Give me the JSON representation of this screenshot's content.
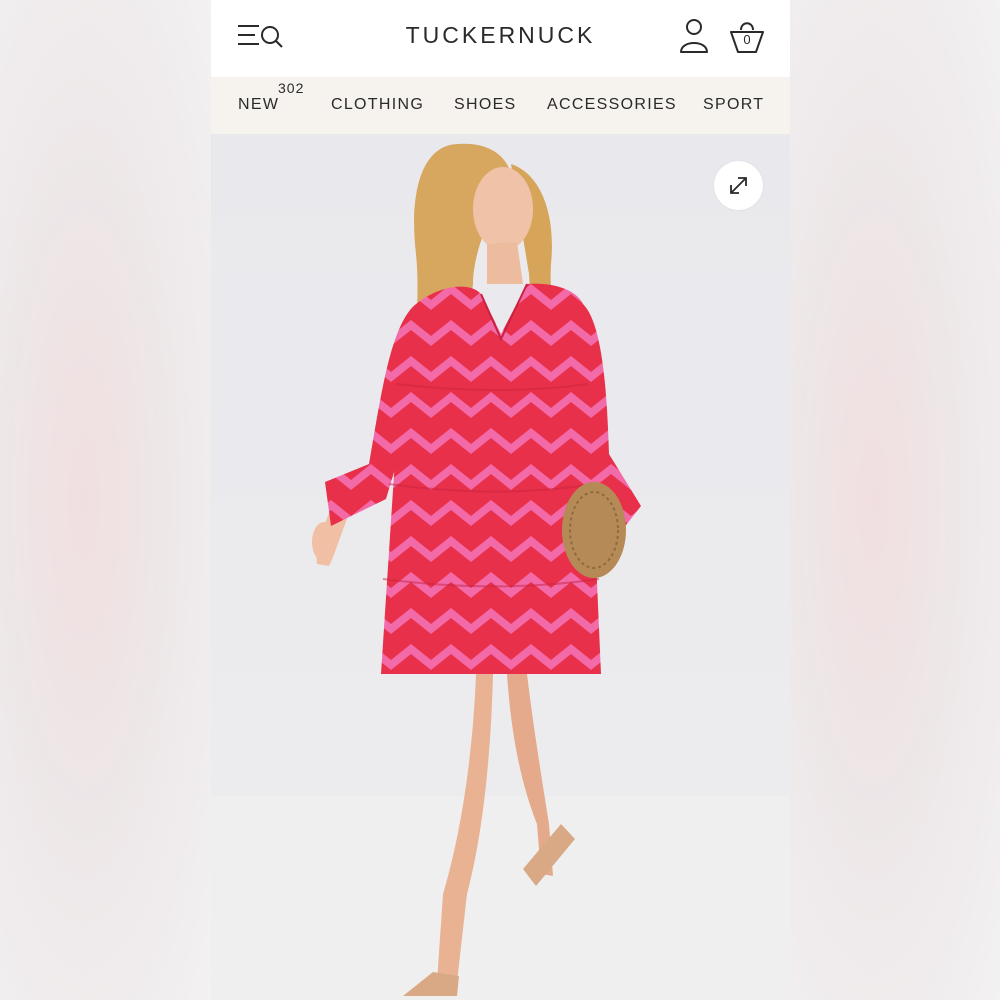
{
  "header": {
    "brand": "TUCKERNUCK",
    "bag_count": "0",
    "icons": {
      "menu": "menu-search-icon",
      "account": "user-icon",
      "bag": "shopping-bag-icon"
    }
  },
  "nav": {
    "items": [
      {
        "label": "NEW",
        "badge": "302"
      },
      {
        "label": "CLOTHING"
      },
      {
        "label": "SHOES"
      },
      {
        "label": "ACCESSORIES"
      },
      {
        "label": "SPORT"
      }
    ]
  },
  "product": {
    "image": "model-in-pink-red-chevron-print-tiered-dress",
    "expand_icon": "expand-arrows-icon"
  },
  "colors": {
    "header_bg": "#ffffff",
    "nav_bg": "#f6f3ee",
    "text": "#2a2a2a",
    "dress_red": "#e8304a",
    "dress_pink": "#f26aa8"
  }
}
